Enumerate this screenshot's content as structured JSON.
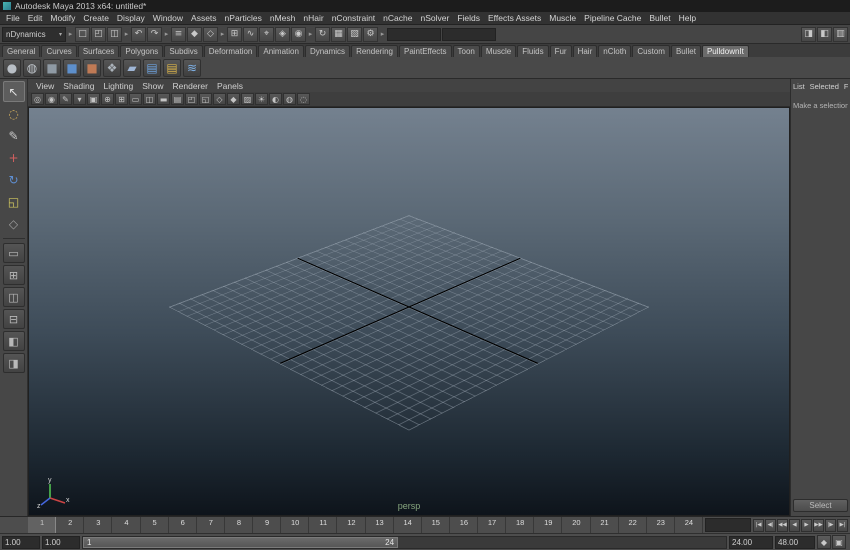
{
  "window": {
    "title": "Autodesk Maya 2013 x64: untitled*"
  },
  "menubar": {
    "items": [
      "File",
      "Edit",
      "Modify",
      "Create",
      "Display",
      "Window",
      "Assets",
      "nParticles",
      "nMesh",
      "nHair",
      "nConstraint",
      "nCache",
      "nSolver",
      "Fields",
      "Effects Assets",
      "Muscle",
      "Pipeline Cache",
      "Bullet",
      "Help"
    ]
  },
  "statusline": {
    "menuset": "nDynamics",
    "menuset_arrow": "▾",
    "items": [
      {
        "kind": "divider",
        "name": "group-collapser-icon",
        "glyph": "▸"
      },
      {
        "kind": "icon",
        "name": "new-scene-icon",
        "glyph": "□"
      },
      {
        "kind": "icon",
        "name": "open-scene-icon",
        "glyph": "◰"
      },
      {
        "kind": "icon",
        "name": "save-scene-icon",
        "glyph": "◫"
      },
      {
        "kind": "divider",
        "name": "group-collapser-icon",
        "glyph": "▸"
      },
      {
        "kind": "icon",
        "name": "undo-icon",
        "glyph": "↶"
      },
      {
        "kind": "icon",
        "name": "redo-icon",
        "glyph": "↷"
      },
      {
        "kind": "divider",
        "name": "group-collapser-icon",
        "glyph": "▸"
      },
      {
        "kind": "icon",
        "name": "select-hierarchy-icon",
        "glyph": "≡"
      },
      {
        "kind": "icon",
        "name": "select-object-icon",
        "glyph": "◆"
      },
      {
        "kind": "icon",
        "name": "select-component-icon",
        "glyph": "◇"
      },
      {
        "kind": "divider",
        "name": "group-collapser-icon",
        "glyph": "▸"
      },
      {
        "kind": "icon",
        "name": "snap-to-grid-icon",
        "glyph": "⊞"
      },
      {
        "kind": "icon",
        "name": "snap-to-curve-icon",
        "glyph": "∿"
      },
      {
        "kind": "icon",
        "name": "snap-to-point-icon",
        "glyph": "⌖"
      },
      {
        "kind": "icon",
        "name": "snap-to-plane-icon",
        "glyph": "◈"
      },
      {
        "kind": "icon",
        "name": "make-live-icon",
        "glyph": "◉"
      },
      {
        "kind": "divider",
        "name": "group-collapser-icon",
        "glyph": "▸"
      },
      {
        "kind": "icon",
        "name": "construction-history-icon",
        "glyph": "↻"
      },
      {
        "kind": "icon",
        "name": "render-icon",
        "glyph": "▦"
      },
      {
        "kind": "icon",
        "name": "ipr-render-icon",
        "glyph": "▧"
      },
      {
        "kind": "icon",
        "name": "render-settings-icon",
        "glyph": "⚙"
      },
      {
        "kind": "divider",
        "name": "group-collapser-icon",
        "glyph": "▸"
      },
      {
        "kind": "field",
        "name": "quick-select-field",
        "glyph": ""
      },
      {
        "kind": "field",
        "name": "numeric-input-field",
        "glyph": ""
      }
    ],
    "right_icons": [
      {
        "name": "show-attribute-editor-icon",
        "glyph": "◨"
      },
      {
        "name": "show-tool-settings-icon",
        "glyph": "◧"
      },
      {
        "name": "show-channel-box-icon",
        "glyph": "▥"
      }
    ]
  },
  "shelf": {
    "tabs": [
      {
        "label": "General"
      },
      {
        "label": "Curves"
      },
      {
        "label": "Surfaces"
      },
      {
        "label": "Polygons"
      },
      {
        "label": "Subdivs"
      },
      {
        "label": "Deformation"
      },
      {
        "label": "Animation"
      },
      {
        "label": "Dynamics"
      },
      {
        "label": "Rendering"
      },
      {
        "label": "PaintEffects"
      },
      {
        "label": "Toon"
      },
      {
        "label": "Muscle"
      },
      {
        "label": "Fluids"
      },
      {
        "label": "Fur"
      },
      {
        "label": "Hair"
      },
      {
        "label": "nCloth"
      },
      {
        "label": "Custom"
      },
      {
        "label": "Bullet"
      },
      {
        "label": "PulldownIt",
        "active": true
      }
    ],
    "icons": [
      {
        "name": "shelf-sphere-icon",
        "glyph": "●",
        "color": "#b9bfc6"
      },
      {
        "name": "shelf-dynamics-icon",
        "glyph": "◍",
        "color": "#c2c8ce"
      },
      {
        "name": "shelf-cube-icon",
        "glyph": "■",
        "color": "#8f9aa4"
      },
      {
        "name": "shelf-fracture-cube-icon",
        "glyph": "■",
        "color": "#5d8fcb"
      },
      {
        "name": "shelf-clay-cube-icon",
        "glyph": "■",
        "color": "#bf7a55"
      },
      {
        "name": "shelf-shatter-icon",
        "glyph": "❖",
        "color": "#aab2ba"
      },
      {
        "name": "shelf-jagged-icon",
        "glyph": "▰",
        "color": "#9fb6d6"
      },
      {
        "name": "shelf-stack-blue-icon",
        "glyph": "▤",
        "color": "#6ea2dd"
      },
      {
        "name": "shelf-stack-gold-icon",
        "glyph": "▤",
        "color": "#d8b24b"
      },
      {
        "name": "shelf-wave-icon",
        "glyph": "≋",
        "color": "#7fb2e8"
      }
    ]
  },
  "toolbox": {
    "tools": [
      {
        "name": "select-tool-icon",
        "glyph": "↖",
        "color": "#e0e0e0",
        "active": true
      },
      {
        "name": "lasso-tool-icon",
        "glyph": "◌",
        "color": "#d8b25f"
      },
      {
        "name": "paint-select-tool-icon",
        "glyph": "✎",
        "color": "#c8c8c8"
      },
      {
        "name": "move-tool-icon",
        "glyph": "+",
        "color": "#d25f5f"
      },
      {
        "name": "rotate-tool-icon",
        "glyph": "↻",
        "color": "#5f8fd2"
      },
      {
        "name": "scale-tool-icon",
        "glyph": "◱",
        "color": "#d2c85f"
      },
      {
        "name": "last-tool-icon",
        "glyph": "◇",
        "color": "#9f9f9f"
      }
    ],
    "layouts": [
      {
        "name": "single-pane-layout-button",
        "glyph": "▭"
      },
      {
        "name": "four-pane-layout-button",
        "glyph": "⊞"
      },
      {
        "name": "persp-outliner-layout-button",
        "glyph": "◫"
      },
      {
        "name": "persp-graph-layout-button",
        "glyph": "⊟"
      },
      {
        "name": "hypershade-persp-layout-button",
        "glyph": "◧"
      },
      {
        "name": "persp-uv-layout-button",
        "glyph": "◨"
      }
    ]
  },
  "panel_menu": {
    "items": [
      "View",
      "Shading",
      "Lighting",
      "Show",
      "Renderer",
      "Panels"
    ]
  },
  "panel_toolbar": {
    "icons": [
      {
        "name": "select-camera-icon",
        "glyph": "◎"
      },
      {
        "name": "lock-camera-icon",
        "glyph": "◉"
      },
      {
        "name": "grease-pencil-icon",
        "glyph": "✎"
      },
      {
        "name": "bookmark-icon",
        "glyph": "▾"
      },
      {
        "name": "image-plane-icon",
        "glyph": "▣"
      },
      {
        "name": "two-d-pan-zoom-icon",
        "glyph": "⊕"
      },
      {
        "name": "grid-toggle-icon",
        "glyph": "⊞"
      },
      {
        "name": "film-gate-icon",
        "glyph": "▭"
      },
      {
        "name": "resolution-gate-icon",
        "glyph": "◫"
      },
      {
        "name": "gate-mask-icon",
        "glyph": "▬"
      },
      {
        "name": "field-chart-icon",
        "glyph": "▤"
      },
      {
        "name": "safe-action-icon",
        "glyph": "◰"
      },
      {
        "name": "safe-title-icon",
        "glyph": "◱"
      },
      {
        "name": "wireframe-icon",
        "glyph": "◇"
      },
      {
        "name": "shaded-icon",
        "glyph": "◆"
      },
      {
        "name": "textured-icon",
        "glyph": "▨"
      },
      {
        "name": "lighting-icon",
        "glyph": "☀"
      },
      {
        "name": "shadows-icon",
        "glyph": "◐"
      },
      {
        "name": "xray-icon",
        "glyph": "◍"
      },
      {
        "name": "isolate-select-icon",
        "glyph": "◌"
      }
    ]
  },
  "viewport": {
    "camera_label": "persp",
    "axis_labels": {
      "x": "x",
      "y": "y",
      "z": "z"
    },
    "axis_colors": {
      "x": "#cc4444",
      "y": "#55cc55",
      "z": "#4466dd"
    },
    "gradient_top": "#74818f",
    "gradient_bottom": "#0e141b"
  },
  "channel_box": {
    "menu": [
      "List",
      "Selected",
      "Foc"
    ],
    "hint": "Make a selection to",
    "select_button": "Select"
  },
  "timeline": {
    "frames": [
      "1",
      "2",
      "3",
      "4",
      "5",
      "6",
      "7",
      "8",
      "9",
      "10",
      "11",
      "12",
      "13",
      "14",
      "15",
      "16",
      "17",
      "18",
      "19",
      "20",
      "21",
      "22",
      "23",
      "24"
    ],
    "current_time": "",
    "playback_buttons": [
      {
        "name": "go-to-start-button",
        "glyph": "|◀"
      },
      {
        "name": "step-back-frame-button",
        "glyph": "◀|"
      },
      {
        "name": "step-back-key-button",
        "glyph": "◀◀"
      },
      {
        "name": "play-backwards-button",
        "glyph": "◀"
      },
      {
        "name": "play-forwards-button",
        "glyph": "▶"
      },
      {
        "name": "step-forward-key-button",
        "glyph": "▶▶"
      },
      {
        "name": "step-forward-frame-button",
        "glyph": "|▶"
      },
      {
        "name": "go-to-end-button",
        "glyph": "▶|"
      }
    ]
  },
  "range": {
    "anim_start": "1.00",
    "play_start": "1.00",
    "bar_start_label": "1",
    "bar_end_label": "24",
    "play_end": "24.00",
    "anim_end": "48.00",
    "buttons": [
      {
        "name": "auto-keyframe-button",
        "glyph": "◆"
      },
      {
        "name": "anim-preferences-button",
        "glyph": "▣"
      }
    ]
  }
}
